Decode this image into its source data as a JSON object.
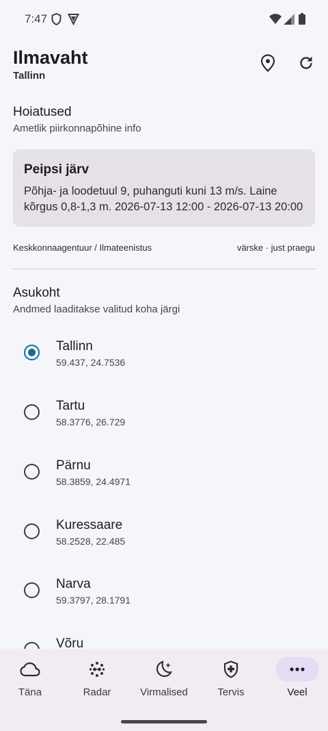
{
  "status_bar": {
    "time": "7:47",
    "icons": [
      "shield-icon",
      "vpn-icon",
      "wifi-icon",
      "signal-icon",
      "battery-icon"
    ]
  },
  "header": {
    "title": "Ilmavaht",
    "subtitle": "Tallinn",
    "actions": [
      "location-pin-icon",
      "refresh-icon"
    ]
  },
  "warnings": {
    "title": "Hoiatused",
    "subtitle": "Ametlik piirkonnapõhine info",
    "card": {
      "title": "Peipsi järv",
      "line1": "Põhja- ja loodetuul 9, puhanguti kuni 13 m/s. Laine",
      "line2": "kõrgus 0,8-1,3 m. 2026-07-13 12:00 - 2026-07-13 20:00"
    },
    "source": "Keskkonnaagentuur / Ilmateenistus",
    "freshness": "värske · just praegu"
  },
  "location": {
    "title": "Asukoht",
    "subtitle": "Andmed laaditakse valitud koha järgi",
    "items": [
      {
        "name": "Tallinn",
        "coords": "59.437, 24.7536",
        "selected": true
      },
      {
        "name": "Tartu",
        "coords": "58.3776, 26.729",
        "selected": false
      },
      {
        "name": "Pärnu",
        "coords": "58.3859, 24.4971",
        "selected": false
      },
      {
        "name": "Kuressaare",
        "coords": "58.2528, 22.485",
        "selected": false
      },
      {
        "name": "Narva",
        "coords": "59.3797, 28.1791",
        "selected": false
      },
      {
        "name": "Võru",
        "coords": "",
        "selected": false
      }
    ]
  },
  "bottom_nav": {
    "items": [
      {
        "label": "Täna",
        "icon": "cloud-icon",
        "active": false
      },
      {
        "label": "Radar",
        "icon": "radar-icon",
        "active": false
      },
      {
        "label": "Virmalised",
        "icon": "moon-stars-icon",
        "active": false
      },
      {
        "label": "Tervis",
        "icon": "health-shield-icon",
        "active": false
      },
      {
        "label": "Veel",
        "icon": "more-icon",
        "active": true
      }
    ]
  },
  "colors": {
    "background": "#f4f6fa",
    "accent": "#146b95",
    "card": "#e6e1e7",
    "nav_background": "#f1ecf3",
    "nav_active_pill": "#e6dcf4"
  }
}
